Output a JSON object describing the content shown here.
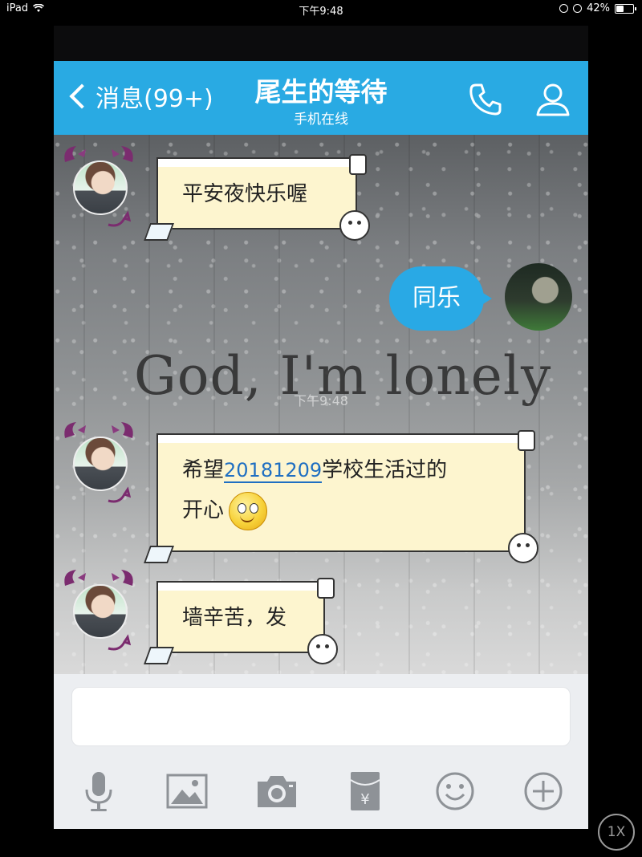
{
  "status_bar": {
    "device": "iPad",
    "time": "下午9:48",
    "battery": "42%",
    "battery_level": 0.42
  },
  "header": {
    "back_label": "消息(99+)",
    "title": "尾生的等待",
    "subtitle": "手机在线",
    "call_icon": "phone-icon",
    "profile_icon": "user-icon"
  },
  "chat": {
    "background_text": "God, I'm lonely",
    "timestamp": "下午9:48",
    "messages": [
      {
        "from": "other",
        "text": "平安夜快乐喔"
      },
      {
        "from": "me",
        "text": "同乐"
      },
      {
        "from": "other",
        "line1_prefix": "希望",
        "link": "20181209",
        "line1_suffix": "学校生活过的",
        "line2": "开心",
        "emoji": "smiley-emoji"
      },
      {
        "from": "other",
        "text": "墙辛苦，发"
      }
    ]
  },
  "input": {
    "value": "",
    "tools": [
      "microphone-icon",
      "image-icon",
      "camera-icon",
      "red-packet-icon",
      "emoji-icon",
      "plus-icon"
    ]
  },
  "zoom_button": "1X",
  "colors": {
    "header_bg": "#29aae3",
    "sent_bubble": "#29a9e5",
    "received_bubble": "#fdf5cf",
    "link": "#1f6fc2"
  }
}
